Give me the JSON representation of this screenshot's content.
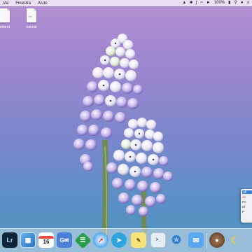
{
  "menubar": {
    "items": [
      "Vai",
      "Finestra",
      "Aiuto"
    ],
    "battery": "100%",
    "status_icons": [
      "upload-icon",
      "finder-icon",
      "bluetooth-icon",
      "wifi-icon",
      "volume-icon",
      "battery-icon",
      "search-icon",
      "siri-icon",
      "list-icon"
    ]
  },
  "desktop": {
    "icons": [
      {
        "label": "mbers",
        "type": "document"
      },
      {
        "label": "tutorial",
        "type": "document"
      }
    ]
  },
  "notification": {
    "lines": [
      "All",
      "Ac",
      "Po",
      "Ef",
      "P"
    ]
  },
  "dock": {
    "calendar_day": "16",
    "apps": [
      "lightroom-icon",
      "windows-icon",
      "calendar-icon",
      "gmail-icon",
      "sheets-icon",
      "safari-icon",
      "telegram-icon",
      "notes-icon",
      "terminal-icon",
      "vscode-icon",
      "mail-icon",
      "trash-icon",
      "wax-seal-icon",
      "banana-icon"
    ]
  },
  "colors": {
    "menubar_bg": "#eee8f5",
    "dock_bg": "#d6deeb",
    "wallpaper_top": "#b48fd0",
    "wallpaper_bottom": "#4a95c0"
  }
}
